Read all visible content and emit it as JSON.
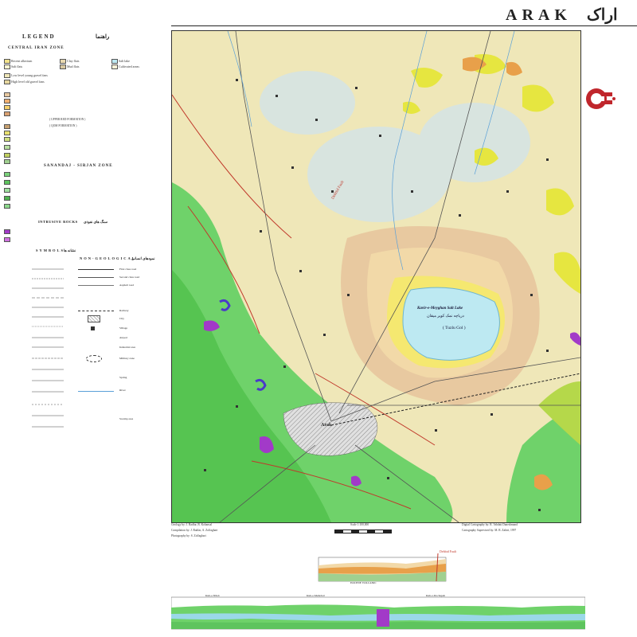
{
  "title": {
    "latin": "ARAK",
    "persian": "اراک"
  },
  "legend": {
    "heading": "LEGEND",
    "heading_fa": "راهنما",
    "central_zone": "CENTRAL IRAN ZONE",
    "sanandaj_zone": "SANANDAJ - SIRJAN ZONE",
    "intrusive": "INTRUSIVE ROCKS",
    "intrusive_fa": "سنگ های نفوذی",
    "symbols": "SYMBOLS",
    "symbols_fa": "نشانه ها",
    "non_geological": "NON-GEOLOGICAL",
    "non_geological_fa": "نمودهای انسانی",
    "items": [
      "Recent alluvium",
      "Salt flats",
      "Clay flats",
      "Mud flats",
      "Salt lake",
      "Cultivated areas",
      "Low level young gravel fans",
      "High level old gravel fans",
      "( UPPER RED FORMATION )",
      "( QOM FORMATION )"
    ],
    "symbols_list": [
      "First class road",
      "Second class road",
      "Asphalt road",
      "Railway",
      "City",
      "Village",
      "Airport",
      "Industrial area",
      "Military zone",
      "Spring",
      "River",
      "Swamp area"
    ]
  },
  "map_labels": {
    "lake_en": "Kavir-e-Meyghan Salt Lake",
    "lake_fa": "دریاچه نمک کویر میقان",
    "lake_sub": "( Tuzlu Gol )",
    "city": "Arak",
    "fault": "Dehbid Fault"
  },
  "credits": {
    "geology": "Geology by: J. Radfar, B. Kohansal",
    "compilation": "Compilation by: J. Radfar, A. Zolfaghari",
    "photography": "Photography by: S. Zolfaghari",
    "cartography": "Digital Cartography by: R. Vahdati Daneshmand",
    "supervision": "Cartography Supervised by: M. R. Zahiri, 1997",
    "scale": "Scale 1:100,000"
  },
  "cross_section": {
    "label_a": "Kuh-e-Nilab",
    "label_b": "Kuh-e-Mehrdad",
    "label_c": "Kuh-e-Dochapeh",
    "volcanic": "EOCENE VOLCANIC",
    "fault_top": "Dehbid Fault"
  },
  "colors": {
    "alluvium": "#efe7b8",
    "green_mountains": "#6fd26a",
    "lake": "#bde9f2",
    "yellow": "#e6e640",
    "beige": "#e8c9a0",
    "purple": "#a23ac8",
    "red": "#c0392b"
  }
}
